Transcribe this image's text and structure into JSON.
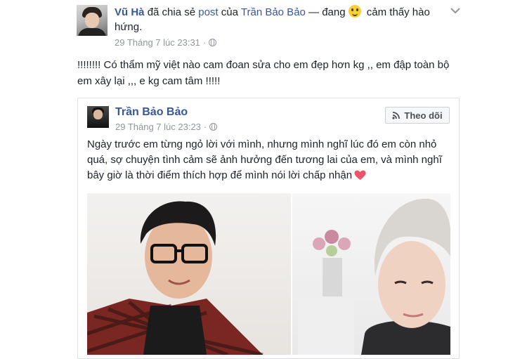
{
  "post": {
    "author": "Vũ Hà",
    "shared_text": "đã chia sẻ",
    "post_link": "post",
    "of_text": "của",
    "original_author": "Trần Bảo Bảo",
    "feeling_prefix": "— đang",
    "feeling": "cảm thấy hào hứng.",
    "timestamp": "29 Tháng 7 lúc 23:31",
    "dot": "·",
    "message": "!!!!!!!! Có thẩm mỹ việt nào cam đoan sửa cho em đẹp hơn kg ,, em đập toàn bộ em xây lại ,,, e kg cam tâm !!!!!"
  },
  "shared": {
    "author": "Trần Bảo Bảo",
    "timestamp": "29 Tháng 7 lúc 23:23",
    "dot": "·",
    "follow_label": "Theo dõi",
    "text": "Ngày trước em từng ngỏ lời với mình, nhưng mình nghĩ lúc đó em còn nhỏ quá, sợ chuyện tình cảm sẽ ảnh hưởng đến tương lai của em, và mình nghĩ bây giờ là thời điểm thích hợp để mình nói lời chấp nhận"
  },
  "icons": {
    "feeling": "smiley-icon",
    "options": "chevron-down-icon",
    "privacy": "globe-icon",
    "follow": "rss-icon",
    "heart": "heart-icon"
  },
  "colors": {
    "link": "#365899",
    "meta": "#90949c",
    "heart": "#f25268"
  }
}
